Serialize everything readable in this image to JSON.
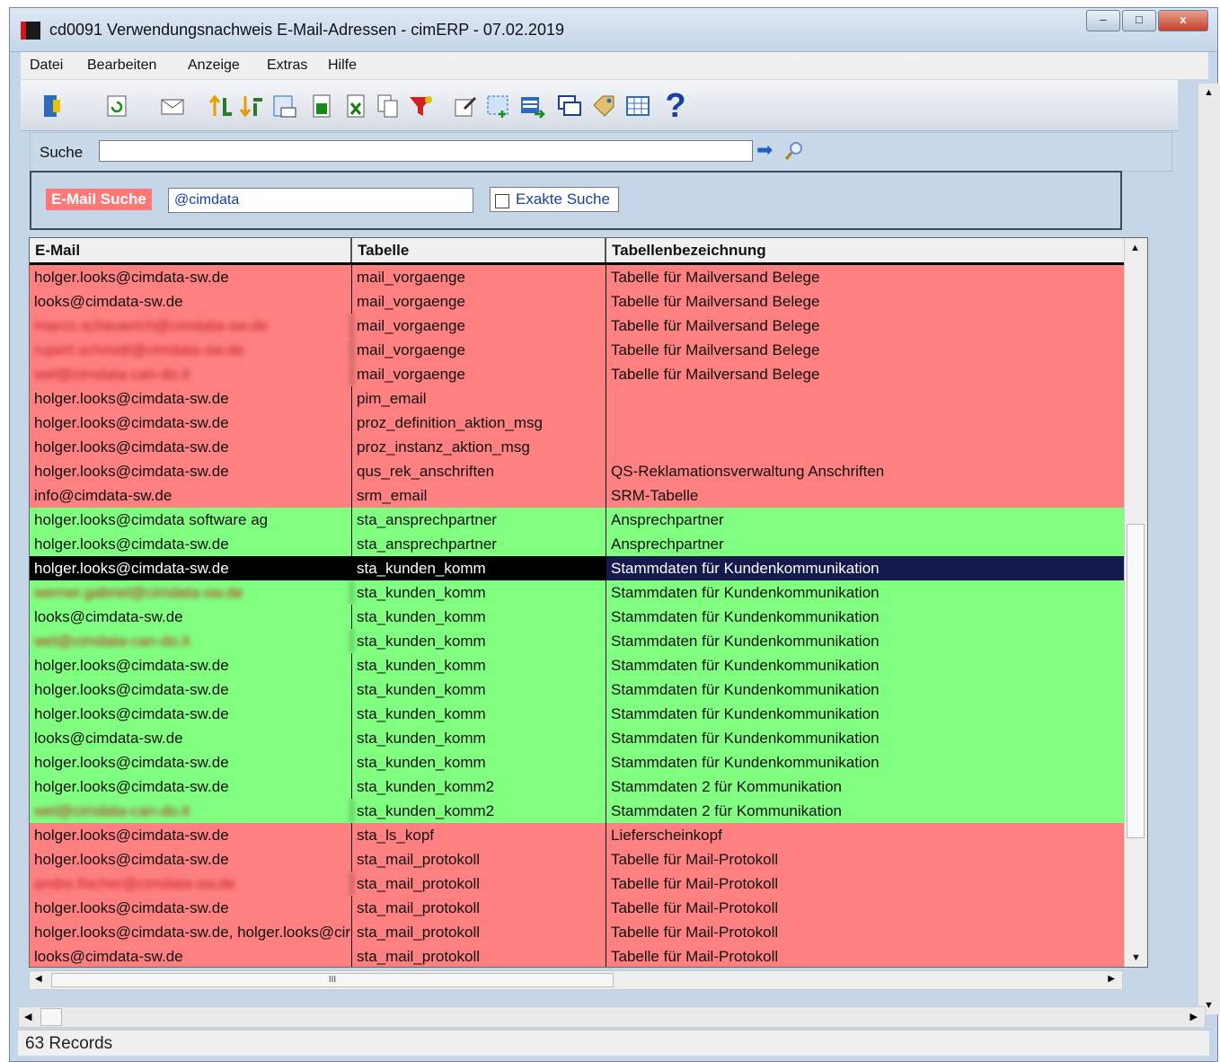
{
  "window": {
    "title": "cd0091 Verwendungsnachweis E-Mail-Adressen - cimERP - 07.02.2019",
    "minimize": "–",
    "maximize": "□",
    "close": "x"
  },
  "menu": [
    "Datei",
    "Bearbeiten",
    "Anzeige",
    "Extras",
    "Hilfe"
  ],
  "toolbar": {
    "icons": [
      "exit-icon",
      "refresh-icon",
      "mail-icon",
      "sort-ascending-icon",
      "sort-descending-icon",
      "number-format-icon",
      "export-icon",
      "excel-icon",
      "copy-icon",
      "filter-icon",
      "edit-icon",
      "select-icon",
      "transfer-icon",
      "windows-icon",
      "tag-icon",
      "grid-icon",
      "help-icon"
    ],
    "help_glyph": "?"
  },
  "search": {
    "label": "Suche",
    "value": ""
  },
  "filter": {
    "email_label": "E-Mail Suche",
    "email_value": "@cimdata",
    "exact_label": "Exakte Suche"
  },
  "grid": {
    "columns": [
      "E-Mail",
      "Tabelle",
      "Tabellenbezeichnung"
    ],
    "rows": [
      {
        "email": "holger.looks@cimdata-sw.de",
        "table": "mail_vorgaenge",
        "desc": "Tabelle für Mailversand Belege",
        "status": "red"
      },
      {
        "email": "looks@cimdata-sw.de",
        "table": "mail_vorgaenge",
        "desc": "Tabelle für Mailversand Belege",
        "status": "red"
      },
      {
        "email": "marco.scheuerich@cimdata-sw.de",
        "table": "mail_vorgaenge",
        "desc": "Tabelle für Mailversand Belege",
        "status": "red",
        "blurred": true
      },
      {
        "email": "rupert.schmidt@cimdata-sw.de",
        "table": "mail_vorgaenge",
        "desc": "Tabelle für Mailversand Belege",
        "status": "red",
        "blurred": true
      },
      {
        "email": "wel@cimdata-can-do.it",
        "table": "mail_vorgaenge",
        "desc": "Tabelle für Mailversand Belege",
        "status": "red",
        "blurred": true
      },
      {
        "email": "holger.looks@cimdata-sw.de",
        "table": "pim_email",
        "desc": "",
        "status": "red"
      },
      {
        "email": "holger.looks@cimdata-sw.de",
        "table": "proz_definition_aktion_msg",
        "desc": "",
        "status": "red"
      },
      {
        "email": "holger.looks@cimdata-sw.de",
        "table": "proz_instanz_aktion_msg",
        "desc": "",
        "status": "red"
      },
      {
        "email": "holger.looks@cimdata-sw.de",
        "table": "qus_rek_anschriften",
        "desc": "QS-Reklamationsverwaltung Anschriften",
        "status": "red"
      },
      {
        "email": "info@cimdata-sw.de",
        "table": "srm_email",
        "desc": "SRM-Tabelle",
        "status": "red"
      },
      {
        "email": "holger.looks@cimdata software ag",
        "table": "sta_ansprechpartner",
        "desc": "Ansprechpartner",
        "status": "green"
      },
      {
        "email": "holger.looks@cimdata-sw.de",
        "table": "sta_ansprechpartner",
        "desc": "Ansprechpartner",
        "status": "green"
      },
      {
        "email": "holger.looks@cimdata-sw.de",
        "table": "sta_kunden_komm",
        "desc": "Stammdaten für Kundenkommunikation",
        "status": "green",
        "selected": true
      },
      {
        "email": "werner.gabriel@cimdata-sw.de",
        "table": "sta_kunden_komm",
        "desc": "Stammdaten für Kundenkommunikation",
        "status": "green",
        "blurred": true
      },
      {
        "email": "looks@cimdata-sw.de",
        "table": "sta_kunden_komm",
        "desc": "Stammdaten für Kundenkommunikation",
        "status": "green"
      },
      {
        "email": "wel@cimdata-can-do.it",
        "table": "sta_kunden_komm",
        "desc": "Stammdaten für Kundenkommunikation",
        "status": "green",
        "blurred": true
      },
      {
        "email": "holger.looks@cimdata-sw.de",
        "table": "sta_kunden_komm",
        "desc": "Stammdaten für Kundenkommunikation",
        "status": "green"
      },
      {
        "email": "holger.looks@cimdata-sw.de",
        "table": "sta_kunden_komm",
        "desc": "Stammdaten für Kundenkommunikation",
        "status": "green"
      },
      {
        "email": "holger.looks@cimdata-sw.de",
        "table": "sta_kunden_komm",
        "desc": "Stammdaten für Kundenkommunikation",
        "status": "green"
      },
      {
        "email": "looks@cimdata-sw.de",
        "table": "sta_kunden_komm",
        "desc": "Stammdaten für Kundenkommunikation",
        "status": "green"
      },
      {
        "email": "holger.looks@cimdata-sw.de",
        "table": "sta_kunden_komm",
        "desc": "Stammdaten für Kundenkommunikation",
        "status": "green"
      },
      {
        "email": "holger.looks@cimdata-sw.de",
        "table": "sta_kunden_komm2",
        "desc": "Stammdaten 2 für Kommunikation",
        "status": "green"
      },
      {
        "email": "wel@cimdata-can-do.it",
        "table": "sta_kunden_komm2",
        "desc": "Stammdaten 2 für Kommunikation",
        "status": "green",
        "blurred": true
      },
      {
        "email": "holger.looks@cimdata-sw.de",
        "table": "sta_ls_kopf",
        "desc": "Lieferscheinkopf",
        "status": "red"
      },
      {
        "email": "holger.looks@cimdata-sw.de",
        "table": "sta_mail_protokoll",
        "desc": "Tabelle für Mail-Protokoll",
        "status": "red"
      },
      {
        "email": "andre.fischer@cimdata-sw.de",
        "table": "sta_mail_protokoll",
        "desc": "Tabelle für Mail-Protokoll",
        "status": "red",
        "blurred": true
      },
      {
        "email": "holger.looks@cimdata-sw.de",
        "table": "sta_mail_protokoll",
        "desc": "Tabelle für Mail-Protokoll",
        "status": "red"
      },
      {
        "email": "holger.looks@cimdata-sw.de, holger.looks@cir",
        "table": "sta_mail_protokoll",
        "desc": "Tabelle für Mail-Protokoll",
        "status": "red"
      },
      {
        "email": "looks@cimdata-sw.de",
        "table": "sta_mail_protokoll",
        "desc": "Tabelle für Mail-Protokoll",
        "status": "red"
      }
    ]
  },
  "hscroll_grip": "III",
  "status": {
    "records": "63 Records"
  },
  "colors": {
    "red_row": "#ff8080",
    "green_row": "#80ff80",
    "selected_row": "#000000",
    "selected_desc": "#141a4e",
    "label_bg": "#ff7878"
  }
}
